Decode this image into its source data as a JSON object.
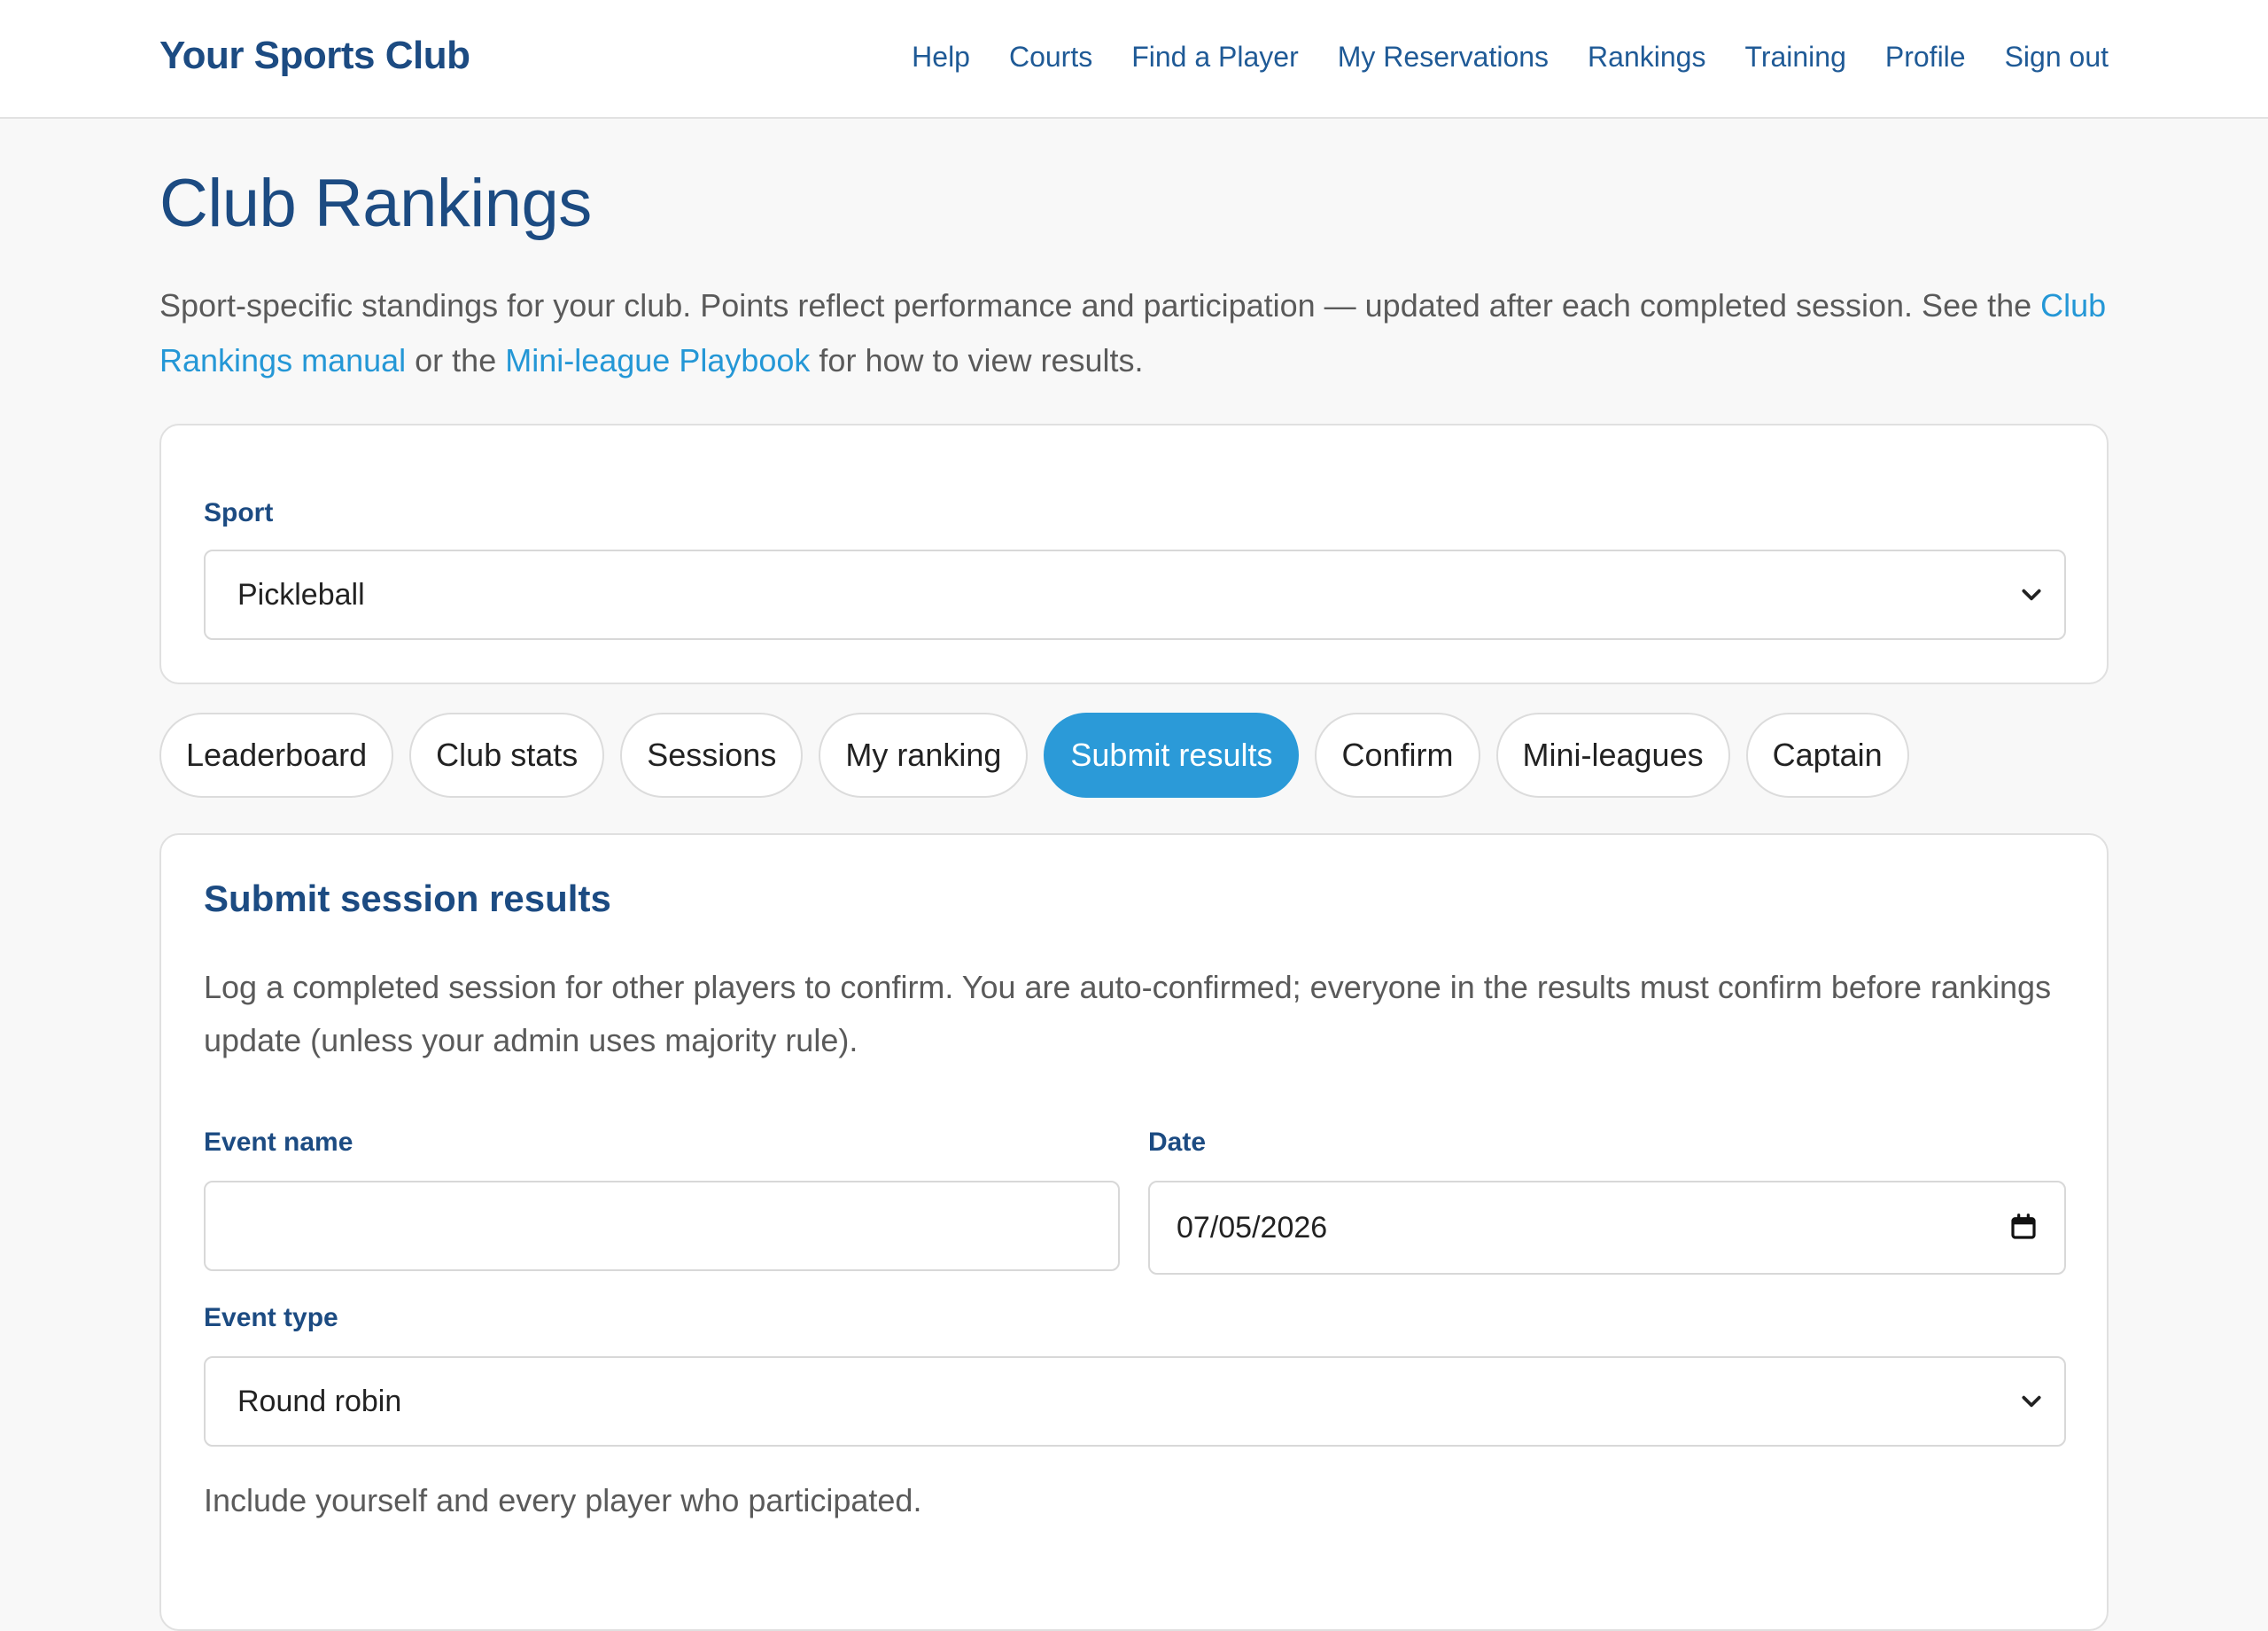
{
  "header": {
    "brand": "Your Sports Club",
    "nav": [
      "Help",
      "Courts",
      "Find a Player",
      "My Reservations",
      "Rankings",
      "Training",
      "Profile",
      "Sign out"
    ]
  },
  "page": {
    "title": "Club Rankings",
    "intro_text_1": "Sport-specific standings for your club. Points reflect performance and participation — updated after each completed session. See the ",
    "link_manual": "Club Rankings manual",
    "intro_text_2": " or the ",
    "link_playbook": "Mini-league Playbook",
    "intro_text_3": " for how to view results."
  },
  "sport": {
    "label": "Sport",
    "value": "Pickleball"
  },
  "tabs": [
    "Leaderboard",
    "Club stats",
    "Sessions",
    "My ranking",
    "Submit results",
    "Confirm",
    "Mini-leagues",
    "Captain"
  ],
  "active_tab": "Submit results",
  "form": {
    "title": "Submit session results",
    "description": "Log a completed session for other players to confirm. You are auto-confirmed; everyone in the results must confirm before rankings update (unless your admin uses majority rule).",
    "event_name_label": "Event name",
    "event_name_value": "",
    "date_label": "Date",
    "date_value": "07/05/2026",
    "event_type_label": "Event type",
    "event_type_value": "Round robin",
    "hint": "Include yourself and every player who participated."
  },
  "icons": {
    "select_chevron": "chevron-down-icon",
    "date_picker": "calendar-icon"
  },
  "colors": {
    "brand": "#1c4b82",
    "nav_link": "#1f5a96",
    "accent": "#2b9ad8",
    "link": "#2497d6"
  }
}
